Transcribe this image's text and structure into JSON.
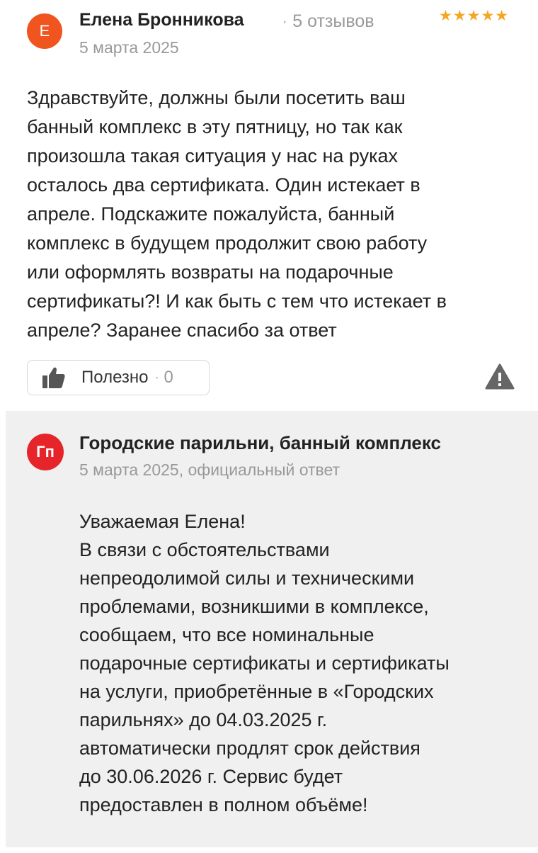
{
  "review": {
    "avatar_letter": "Е",
    "avatar_color": "#f0551f",
    "author": "Елена Бронникова",
    "separator": "·",
    "reviews_count": "5 отзывов",
    "date": "5 марта 2025",
    "rating": 5,
    "stars": "★★★★★",
    "text_lines": [
      "Здравствуйте, должны были посетить ваш",
      "банный комплекс в эту пятницу, но так как",
      "произошла такая ситуация у нас на руках",
      "осталось два сертификата. Один истекает в",
      "апреле. Подскажите пожалуйста, банный",
      "комплекс в будущем продолжит свою работу",
      "или оформлять возвраты на подарочные",
      "сертификаты?! И как быть с тем что истекает в",
      "апреле? Заранее спасибо за ответ"
    ],
    "useful_label": "Полезно",
    "useful_separator": "·",
    "useful_count": "0",
    "thumb_icon": "thumbs-up-icon",
    "report_icon": "warning-icon"
  },
  "reply": {
    "avatar_letters": "Гп",
    "avatar_color": "#e5252a",
    "org_name": "Городские парильни, банный комплекс",
    "meta": "5 марта 2025, официальный ответ",
    "text_lines": [
      "Уважаемая Елена!",
      "В связи с обстоятельствами",
      "непреодолимой силы и техническими",
      "проблемами, возникшими в комплексе,",
      "сообщаем, что все номинальные",
      "подарочные сертификаты и сертификаты",
      "на услуги, приобретённые в «Городских",
      "парильнях» до 04.03.2025 г.",
      "автоматически продлят срок действия",
      "до 30.06.2026 г. Сервис будет",
      "предоставлен в полном объёме!"
    ]
  }
}
